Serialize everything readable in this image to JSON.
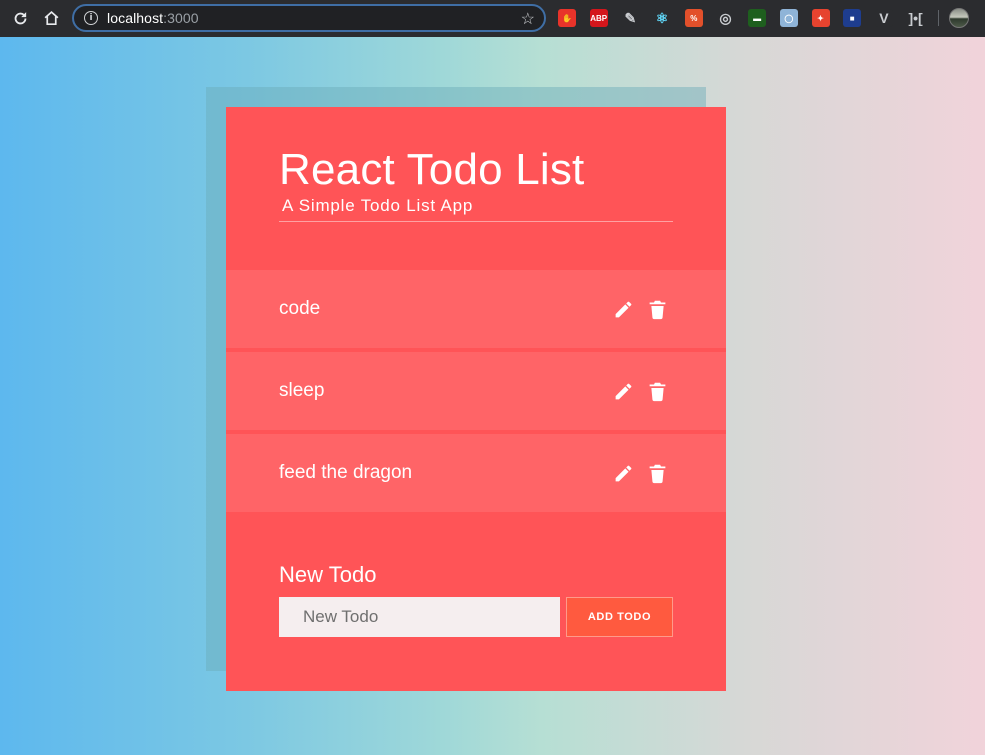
{
  "browser": {
    "url_host": "localhost",
    "url_port": ":3000",
    "extensions": [
      {
        "icon": "hand-stop-icon",
        "color": "#e8332a",
        "glyph": "✋"
      },
      {
        "icon": "adblock-plus-icon",
        "color": "#d4161c",
        "glyph": "ABP"
      },
      {
        "icon": "pen-icon",
        "color": "#2b2c2f",
        "glyph": "✎"
      },
      {
        "icon": "react-devtools-icon",
        "color": "#2b2c2f",
        "glyph": "⚛"
      },
      {
        "icon": "percent-icon",
        "color": "#e2502b",
        "glyph": "%"
      },
      {
        "icon": "target-icon",
        "color": "#2b2c2f",
        "glyph": "◎"
      },
      {
        "icon": "folder-icon",
        "color": "#1e5f1e",
        "glyph": "▬"
      },
      {
        "icon": "ring-icon",
        "color": "#8fb4d8",
        "glyph": "◯"
      },
      {
        "icon": "puzzle-icon",
        "color": "#e6432f",
        "glyph": "✦"
      },
      {
        "icon": "square-icon",
        "color": "#1e3d8f",
        "glyph": "■"
      },
      {
        "icon": "vue-devtools-icon",
        "color": "#2b2c2f",
        "glyph": "V"
      },
      {
        "icon": "bracket-icon",
        "color": "#2b2c2f",
        "glyph": "]•["
      }
    ]
  },
  "app": {
    "title": "React Todo List",
    "subtitle": "A Simple Todo List App",
    "todos": [
      {
        "text": "code"
      },
      {
        "text": "sleep"
      },
      {
        "text": "feed the dragon"
      }
    ],
    "new_todo": {
      "label": "New Todo",
      "placeholder": "New Todo",
      "value": "",
      "button_label": "ADD TODO"
    }
  },
  "colors": {
    "card": "#ff5457",
    "todo_row": "#ff6467",
    "add_button": "#ff5a3f"
  }
}
